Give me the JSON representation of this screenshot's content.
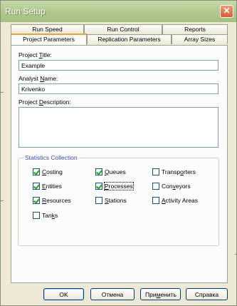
{
  "window": {
    "title": "Run Setup",
    "close_glyph": "✕"
  },
  "tabs_row1": [
    "Run Speed",
    "Run Control",
    "Reports"
  ],
  "tabs_row2": [
    "Project Parameters",
    "Replication Parameters",
    "Array Sizes"
  ],
  "active_tab": "Project Parameters",
  "fields": {
    "title_label": {
      "before": "Project ",
      "key": "T",
      "after": "itle:"
    },
    "title_value": "Example",
    "analyst_label": {
      "before": "Analyst ",
      "key": "N",
      "after": "ame:"
    },
    "analyst_value": "Krivenko",
    "description_label": {
      "before": "Project ",
      "key": "D",
      "after": "escription:"
    },
    "description_value": ""
  },
  "statistics": {
    "title": "Statistics Collection",
    "items": [
      {
        "before": "",
        "key": "C",
        "after": "osting",
        "checked": true
      },
      {
        "before": "",
        "key": "Q",
        "after": "ueues",
        "checked": true
      },
      {
        "before": "Transp",
        "key": "o",
        "after": "rters",
        "checked": false
      },
      {
        "before": "",
        "key": "E",
        "after": "ntities",
        "checked": true
      },
      {
        "before": "",
        "key": "P",
        "after": "rocesses",
        "checked": true
      },
      {
        "before": "Con",
        "key": "v",
        "after": "eyors",
        "checked": false
      },
      {
        "before": "",
        "key": "R",
        "after": "esources",
        "checked": true
      },
      {
        "before": "",
        "key": "S",
        "after": "tations",
        "checked": false
      },
      {
        "before": "",
        "key": "A",
        "after": "ctivity Areas",
        "checked": false
      },
      {
        "before": "Tan",
        "key": "k",
        "after": "s",
        "checked": false
      }
    ]
  },
  "buttons": {
    "ok": "OK",
    "cancel": "Отмена",
    "apply": {
      "before": "При",
      "key": "м",
      "after": "енить"
    },
    "help": "Справка"
  }
}
